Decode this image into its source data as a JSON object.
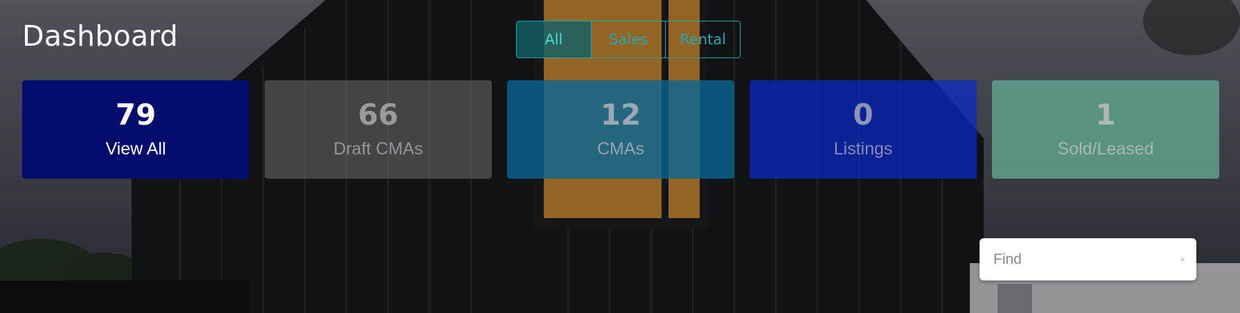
{
  "header": {
    "title": "Dashboard"
  },
  "filter": {
    "options": [
      {
        "label": "All",
        "active": true
      },
      {
        "label": "Sales",
        "active": false
      },
      {
        "label": "Rental",
        "active": false
      }
    ]
  },
  "cards": [
    {
      "count": "79",
      "label": "View All",
      "color": "#020d6e"
    },
    {
      "count": "66",
      "label": "Draft CMAs",
      "color": "#6e6e70"
    },
    {
      "count": "12",
      "label": "CMAs",
      "color": "#076896"
    },
    {
      "count": "0",
      "label": "Listings",
      "color": "#0a28c8"
    },
    {
      "count": "1",
      "label": "Sold/Leased",
      "color": "#60aa92"
    }
  ],
  "search": {
    "placeholder": "Find",
    "value": "",
    "icon": "search-icon"
  }
}
